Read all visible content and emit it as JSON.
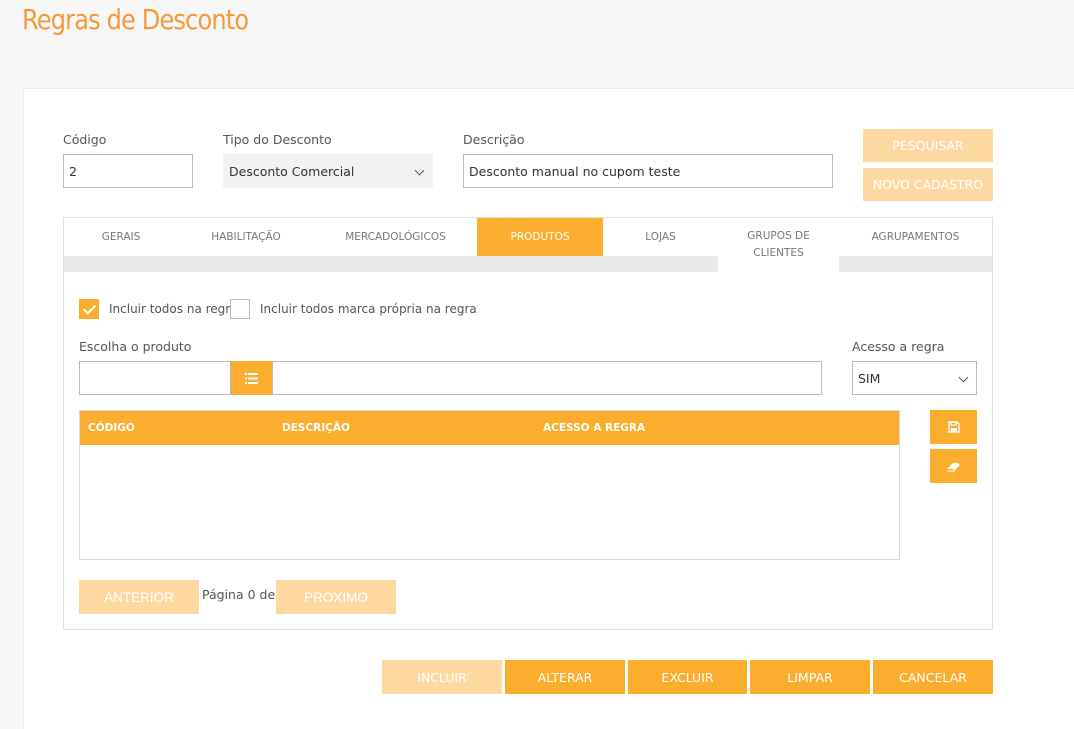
{
  "page": {
    "title": "Regras de Desconto"
  },
  "form": {
    "codigo_label": "Código",
    "codigo_value": "2",
    "tipo_label": "Tipo do Desconto",
    "tipo_value": "Desconto Comercial",
    "descricao_label": "Descrição",
    "descricao_value": "Desconto manual no cupom teste"
  },
  "actions": {
    "pesquisar": "PESQUISAR",
    "novo_cadastro": "NOVO CADASTRO"
  },
  "tabs": [
    {
      "label": "GERAIS",
      "active": false
    },
    {
      "label": "HABILITAÇÃO",
      "active": false
    },
    {
      "label": "MERCADOLÓGICOS",
      "active": false
    },
    {
      "label": "PRODUTOS",
      "active": true
    },
    {
      "label": "LOJAS",
      "active": false
    },
    {
      "label": "GRUPOS DE CLIENTES",
      "active": false
    },
    {
      "label": "AGRUPAMENTOS",
      "active": false
    }
  ],
  "produtos": {
    "incluir_todos_label": "Incluir todos na regra",
    "incluir_todos_checked": true,
    "incluir_marca_label": "Incluir todos marca própria na regra",
    "incluir_marca_checked": false,
    "escolha_label": "Escolha o produto",
    "escolha_code_value": "",
    "escolha_desc_value": "",
    "acesso_label": "Acesso a regra",
    "acesso_value": "SIM",
    "table": {
      "columns": [
        "CÓDIGO",
        "DESCRIÇÃO",
        "ACESSO A REGRA"
      ],
      "rows": []
    },
    "side_icons": [
      "save-icon",
      "eraser-icon"
    ]
  },
  "pager": {
    "prev": "ANTERIOR",
    "info": "Página 0 de 0",
    "next": "PROXIMO"
  },
  "footer": {
    "incluir": "INCLUIR",
    "alterar": "ALTERAR",
    "excluir": "EXCLUIR",
    "limpar": "LIMPAR",
    "cancelar": "CANCELAR"
  },
  "colors": {
    "accent": "#fbad2e",
    "accent_disabled": "#fdd8a1",
    "title": "#f59a3a"
  }
}
